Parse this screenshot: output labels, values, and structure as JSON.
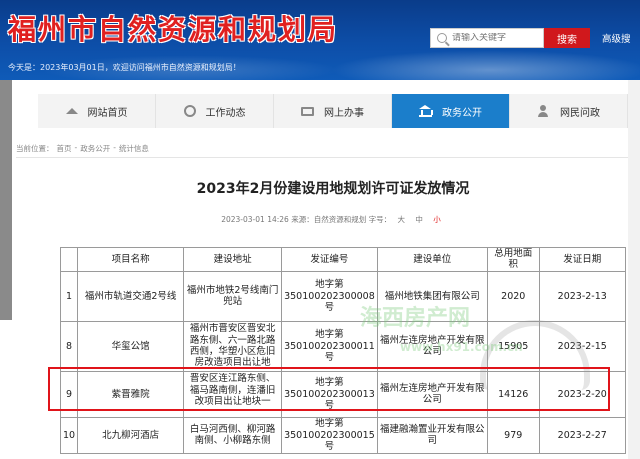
{
  "header": {
    "site_title": "福州市自然资源和规划局",
    "search_placeholder": "请输入关键字",
    "search_button": "搜索",
    "advanced_search": "高级搜",
    "welcome": "今天是：2023年03月01日，欢迎访问福州市自然资源和规划局！"
  },
  "nav": {
    "items": [
      {
        "label": "网站首页",
        "icon": "home-icon"
      },
      {
        "label": "工作动态",
        "icon": "gear-icon"
      },
      {
        "label": "网上办事",
        "icon": "monitor-icon"
      },
      {
        "label": "政务公开",
        "icon": "bank-icon",
        "active": true
      },
      {
        "label": "网民问政",
        "icon": "person-icon"
      }
    ]
  },
  "breadcrumb": {
    "label": "当前位置：",
    "items": [
      "首页",
      "政务公开",
      "统计信息"
    ],
    "separator": "-"
  },
  "article": {
    "title": "2023年2月份建设用地规划许可证发放情况",
    "date": "2023-03-01 14:26",
    "source": "来源：自然资源和规划",
    "font_label": "字号：",
    "size_large": "大",
    "size_medium": "中",
    "size_small": "小"
  },
  "table": {
    "headers": [
      "",
      "项目名称",
      "建设地址",
      "发证编号",
      "建设单位",
      "总用地面积",
      "发证日期"
    ],
    "rows": [
      {
        "no": "1",
        "name": "福州市轨道交通2号线",
        "address": "福州市地铁2号线南门兜站",
        "permit": "地字第350100202300008号",
        "unit": "福州地铁集团有限公司",
        "area": "2020",
        "date": "2023-2-13"
      },
      {
        "no": "8",
        "name": "华玺公馆",
        "address": "福州市晋安区晋安北路东侧、六一路北路西侧，华塑小区危旧房改造项目出让地",
        "permit": "地字第350100202300011号",
        "unit": "福州左连房地产开发有限公司",
        "area": "15905",
        "date": "2023-2-15"
      },
      {
        "no": "9",
        "name": "紫晋雅院",
        "address": "晋安区连江路东侧、福马路南侧，连潘旧改项目出让地块一",
        "permit": "地字第350100202300013号",
        "unit": "福州左连房地产开发有限公司",
        "area": "14126",
        "date": "2023-2-20"
      },
      {
        "no": "10",
        "name": "北九柳河酒店",
        "address": "白马河西侧、柳河路南侧、小柳路东侧",
        "permit": "地字第350100202300015号",
        "unit": "福建融瀚置业开发有限公司",
        "area": "979",
        "date": "2023-2-27"
      }
    ]
  },
  "watermark": {
    "line1": "海西房产网",
    "line2": "www.hx91.com.cn"
  },
  "colors": {
    "header_blue": "#0d4ea8",
    "nav_active": "#1b7ecb",
    "search_red": "#d0181c",
    "highlight_red": "#e0141a"
  }
}
